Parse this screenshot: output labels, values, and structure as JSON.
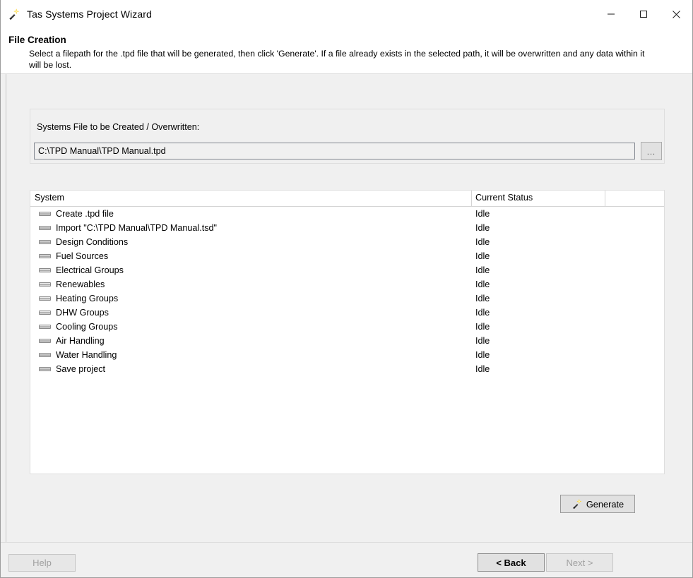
{
  "window": {
    "title": "Tas Systems Project Wizard",
    "icon": "magic-wand-icon",
    "minimize_label": "—",
    "maximize_label": "□",
    "close_label": "✕"
  },
  "header": {
    "title": "File Creation",
    "description": "Select a filepath for the .tpd file that will be generated, then click 'Generate'. If a file already exists in the selected path, it will be overwritten and any data within it will be lost."
  },
  "file_group": {
    "label": "Systems File to be Created / Overwritten:",
    "path_value": "C:\\TPD Manual\\TPD Manual.tpd",
    "path_placeholder": "",
    "browse_label": "..."
  },
  "list": {
    "columns": [
      "System",
      "Current Status"
    ],
    "rows": [
      {
        "system": "Create .tpd file",
        "status": "Idle"
      },
      {
        "system": "Import \"C:\\TPD Manual\\TPD Manual.tsd\"",
        "status": "Idle"
      },
      {
        "system": "Design Conditions",
        "status": "Idle"
      },
      {
        "system": "Fuel Sources",
        "status": "Idle"
      },
      {
        "system": "Electrical Groups",
        "status": "Idle"
      },
      {
        "system": "Renewables",
        "status": "Idle"
      },
      {
        "system": "Heating Groups",
        "status": "Idle"
      },
      {
        "system": "DHW Groups",
        "status": "Idle"
      },
      {
        "system": "Cooling Groups",
        "status": "Idle"
      },
      {
        "system": "Air Handling",
        "status": "Idle"
      },
      {
        "system": "Water Handling",
        "status": "Idle"
      },
      {
        "system": "Save project",
        "status": "Idle"
      }
    ]
  },
  "actions": {
    "generate_label": "Generate",
    "generate_icon": "magic-wand-icon"
  },
  "footer": {
    "help_label": "Help",
    "back_label": "< Back",
    "next_label": "Next >"
  },
  "colors": {
    "window_bg": "#f0f0f0",
    "panel_bg": "#ffffff",
    "accent_wand": "#ffd42a",
    "border": "#dedede"
  }
}
